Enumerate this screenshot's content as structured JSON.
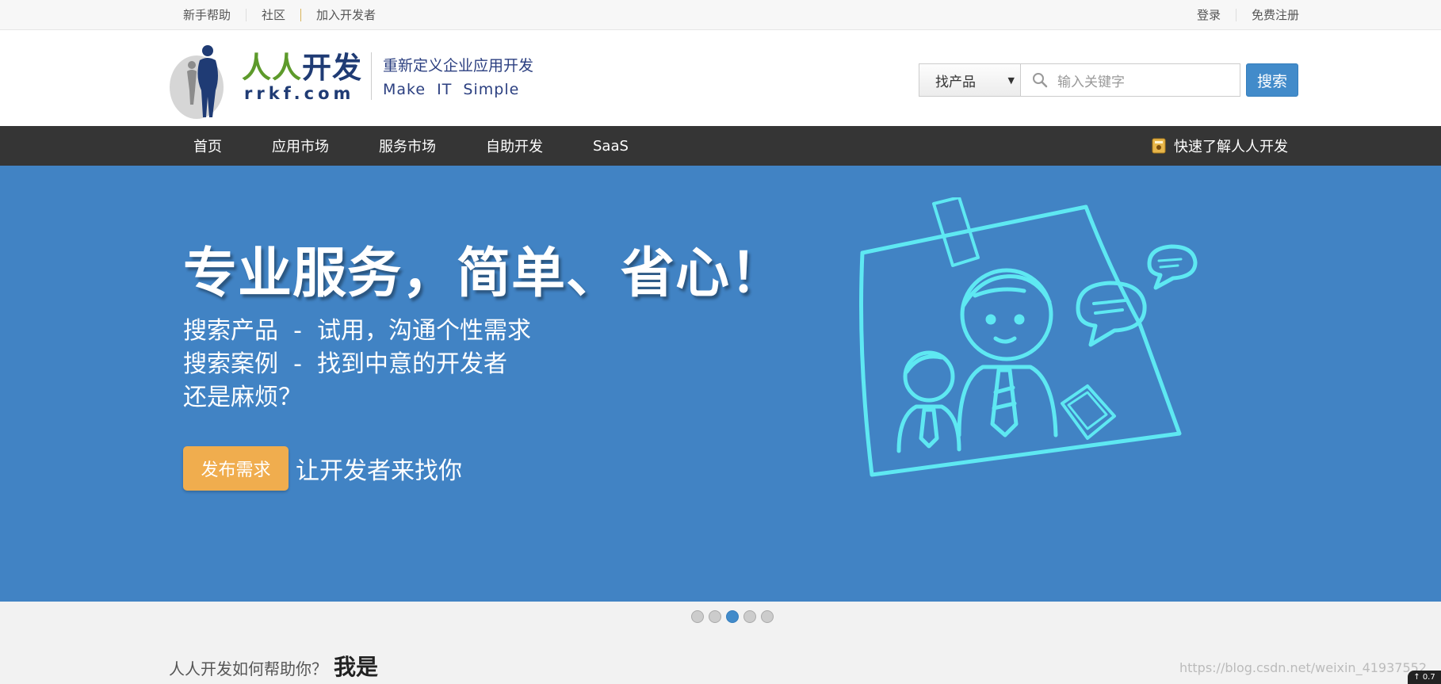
{
  "topbar": {
    "left_links": [
      "新手帮助",
      "社区",
      "加入开发者"
    ],
    "right_links": [
      "登录",
      "免费注册"
    ]
  },
  "header": {
    "brand_cn_part1": "人人",
    "brand_cn_part2": "开发",
    "brand_en": "rrkf.com",
    "tagline_cn": "重新定义企业应用开发",
    "tagline_en": "Make  IT  Simple"
  },
  "search": {
    "category_selected": "找产品",
    "placeholder": "输入关键字",
    "button_label": "搜索"
  },
  "nav": {
    "items": [
      "首页",
      "应用市场",
      "服务市场",
      "自助开发",
      "SaaS"
    ],
    "quick_link": "快速了解人人开发"
  },
  "banner": {
    "title": "专业服务，简单、省心！",
    "lines": [
      "搜索产品  -  试用，沟通个性需求",
      "搜索案例  -  找到中意的开发者",
      "还是麻烦？"
    ],
    "cta_button": "发布需求",
    "cta_text": "让开发者来找你"
  },
  "carousel": {
    "count": 5,
    "active_index": 2
  },
  "help": {
    "question": "人人开发如何帮助你？",
    "strong": "我是"
  },
  "watermark": "https://blog.csdn.net/weixin_41937552",
  "corner_badge": "↑ 0.7",
  "colors": {
    "nav_bg": "#353535",
    "banner_bg": "#4183c4",
    "search_btn": "#428bca",
    "cta": "#f0ad4e",
    "illustration_line": "#5ee8f2"
  }
}
